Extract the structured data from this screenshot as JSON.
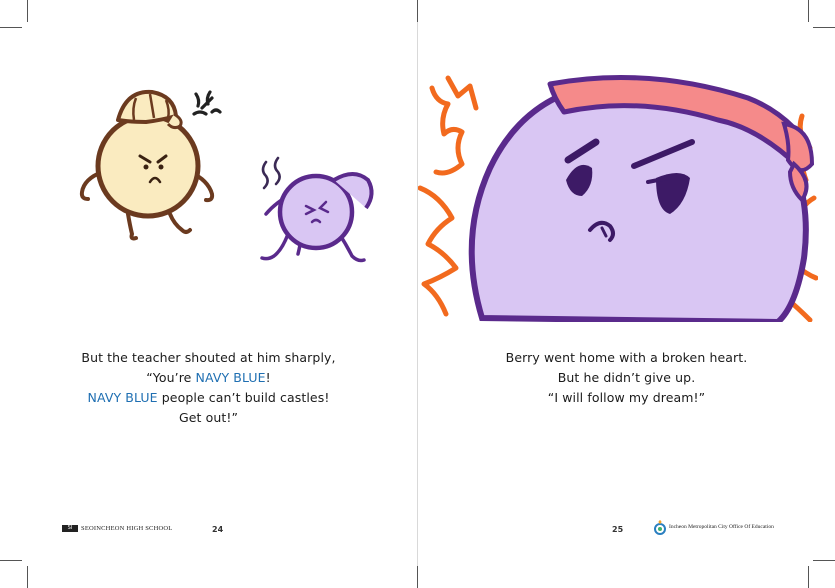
{
  "left_page": {
    "story_lines": [
      {
        "before": "But the teacher shouted at him sharply,",
        "highlight": "",
        "after": ""
      },
      {
        "before": "“You’re ",
        "highlight": "NAVY BLUE",
        "after": "!"
      },
      {
        "before": "",
        "highlight": "NAVY BLUE",
        "after": " people can’t build castles!"
      },
      {
        "before": "Get out!”",
        "highlight": "",
        "after": ""
      }
    ],
    "page_number": "24",
    "footer_logo_text": "SI",
    "footer_text": "SEOINCHEON HIGH SCHOOL"
  },
  "right_page": {
    "story_lines": [
      "Berry went home with a broken heart.",
      "But he didn’t give up.",
      "“I will follow my dream!”"
    ],
    "page_number": "25",
    "footer_text": "Incheon Metropolitan City Office Of Education"
  },
  "colors": {
    "highlight": "#1f6fb2",
    "berry_fill": "#d9c6f3",
    "berry_outline": "#5a2a8c",
    "teacher_fill": "#faebc0",
    "teacher_outline": "#6b3a1f",
    "flame": "#f26a1e",
    "headband": "#f58a8a"
  },
  "illustrations": [
    "teacher-character-icon",
    "anger-mark-icon",
    "berry-character-icon",
    "sweat-lines-icon",
    "angry-berry-closeup",
    "flames-icon",
    "office-logo-icon"
  ]
}
